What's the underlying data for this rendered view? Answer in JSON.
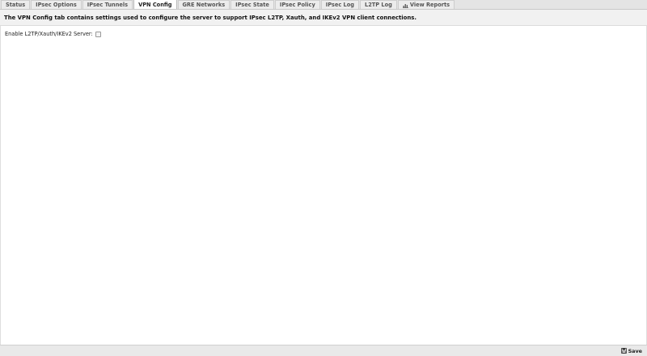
{
  "tabs": [
    {
      "label": "Status",
      "active": false
    },
    {
      "label": "IPsec Options",
      "active": false
    },
    {
      "label": "IPsec Tunnels",
      "active": false
    },
    {
      "label": "VPN Config",
      "active": true
    },
    {
      "label": "GRE Networks",
      "active": false
    },
    {
      "label": "IPsec State",
      "active": false
    },
    {
      "label": "IPsec Policy",
      "active": false
    },
    {
      "label": "IPsec Log",
      "active": false
    },
    {
      "label": "L2TP Log",
      "active": false
    },
    {
      "label": "View Reports",
      "active": false,
      "icon": "chart-icon"
    }
  ],
  "description": "The VPN Config tab contains settings used to configure the server to support IPsec L2TP, Xauth, and IKEv2 VPN client connections.",
  "form": {
    "enable_server_label": "Enable L2TP/Xauth/IKEv2 Server:",
    "enable_server_checked": false
  },
  "footer": {
    "save_label": "Save",
    "save_icon": "floppy-disk-icon"
  }
}
